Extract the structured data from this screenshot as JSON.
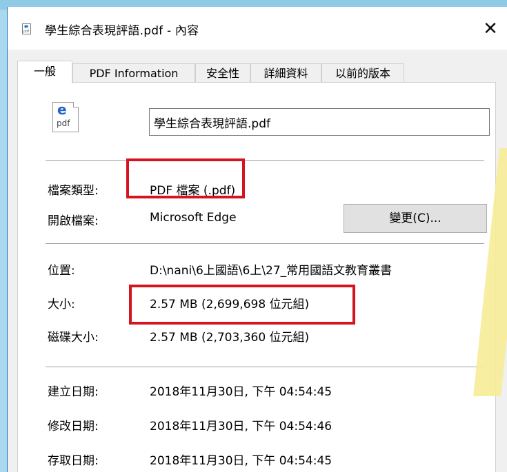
{
  "window": {
    "title": "學生綜合表現評語.pdf - 內容",
    "close_glyph": "✕"
  },
  "icon": {
    "letter": "e",
    "ext": "pdf"
  },
  "tabs": [
    {
      "label": "一般",
      "active": true
    },
    {
      "label": "PDF Information",
      "active": false
    },
    {
      "label": "安全性",
      "active": false
    },
    {
      "label": "詳細資料",
      "active": false
    },
    {
      "label": "以前的版本",
      "active": false
    }
  ],
  "general": {
    "file_name": "學生綜合表現評語.pdf",
    "type_label": "檔案類型:",
    "type_value": "PDF 檔案 (.pdf)",
    "opens_label": "開啟檔案:",
    "opens_value": "Microsoft Edge",
    "change_button": "變更(C)...",
    "location_label": "位置:",
    "location_value": "D:\\nani\\6上國語\\6上\\27_常用國語文教育叢書",
    "size_label": "大小:",
    "size_value": "2.57 MB (2,699,698 位元組)",
    "disk_label": "磁碟大小:",
    "disk_value": "2.57 MB (2,703,360 位元組)",
    "created_label": "建立日期:",
    "created_value": "2018年11月30日, 下午 04:54:45",
    "modified_label": "修改日期:",
    "modified_value": "2018年11月30日, 下午 04:54:46",
    "accessed_label": "存取日期:",
    "accessed_value": "2018年11月30日, 下午 04:54:45"
  },
  "colors": {
    "highlight": "#d4151f",
    "background": "#a9d8ef",
    "dialog": "#f0f0f0"
  }
}
